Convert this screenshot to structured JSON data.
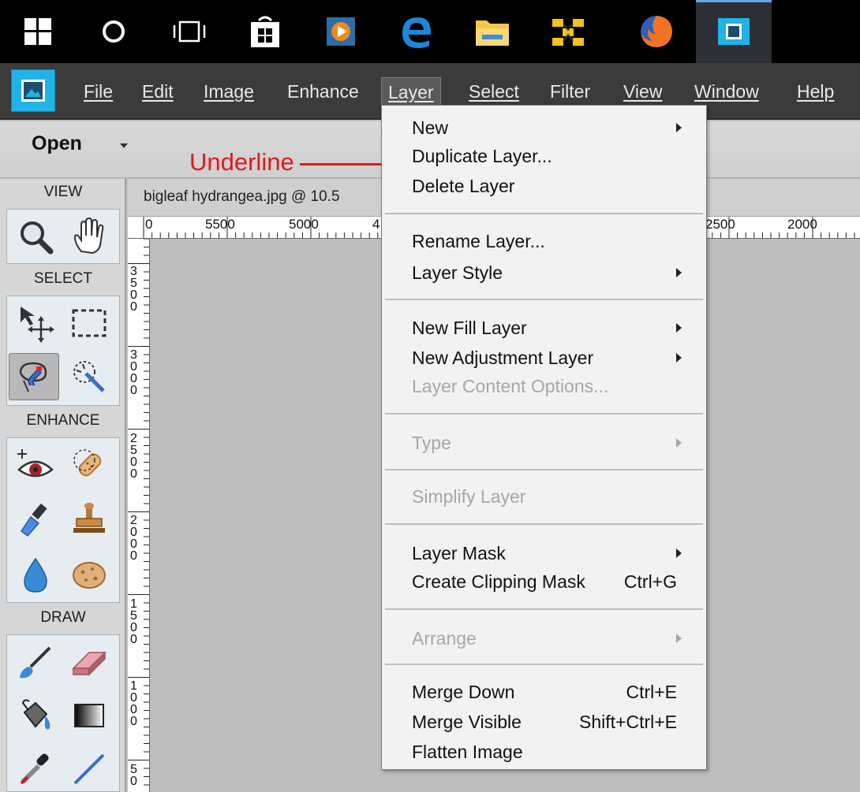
{
  "taskbar": {
    "items": [
      "start-icon",
      "search-icon",
      "task-view-icon",
      "store-icon",
      "media-player-icon",
      "edge-icon",
      "file-explorer-icon",
      "network-icon",
      "firefox-icon",
      "photoshop-elements-icon"
    ]
  },
  "menubar": {
    "items": [
      {
        "label": "File"
      },
      {
        "label": "Edit"
      },
      {
        "label": "Image"
      },
      {
        "label": "Enhance"
      },
      {
        "label": "Layer"
      },
      {
        "label": "Select"
      },
      {
        "label": "Filter"
      },
      {
        "label": "View"
      },
      {
        "label": "Window"
      },
      {
        "label": "Help"
      }
    ]
  },
  "options": {
    "open_label": "Open"
  },
  "toolbox": {
    "sections": {
      "view": "VIEW",
      "select": "SELECT",
      "enhance": "ENHANCE",
      "draw": "DRAW"
    }
  },
  "document": {
    "tab_title": "bigleaf hydrangea.jpg @ 10.5",
    "ruler_top": [
      "0",
      "5500",
      "5000",
      "4",
      "2500",
      "2000"
    ],
    "ruler_left": [
      "3\n5\n0\n0",
      "3\n0\n0\n0",
      "2\n5\n0\n0",
      "2\n0\n0\n0",
      "1\n5\n0\n0",
      "1\n0\n0\n0",
      "5\n0"
    ]
  },
  "annotation": {
    "label": "Underline"
  },
  "layer_menu": {
    "items": [
      {
        "label": "New"
      },
      {
        "label": "Duplicate Layer..."
      },
      {
        "label": "Delete Layer"
      },
      {
        "label": "Rename Layer..."
      },
      {
        "label": "Layer Style"
      },
      {
        "label": "New Fill Layer"
      },
      {
        "label": "New Adjustment Layer"
      },
      {
        "label": "Layer Content Options..."
      },
      {
        "label": "Type"
      },
      {
        "label": "Simplify Layer"
      },
      {
        "label": "Layer Mask"
      },
      {
        "label": "Create Clipping Mask",
        "shortcut": "Ctrl+G"
      },
      {
        "label": "Arrange"
      },
      {
        "label": "Merge Down",
        "shortcut": "Ctrl+E"
      },
      {
        "label": "Merge Visible",
        "shortcut": "Shift+Ctrl+E"
      },
      {
        "label": "Flatten Image"
      }
    ]
  },
  "colors": {
    "menubar_bg": "#3b3b3b",
    "annotation": "#e0191b",
    "app_accent": "#20b3e8"
  }
}
